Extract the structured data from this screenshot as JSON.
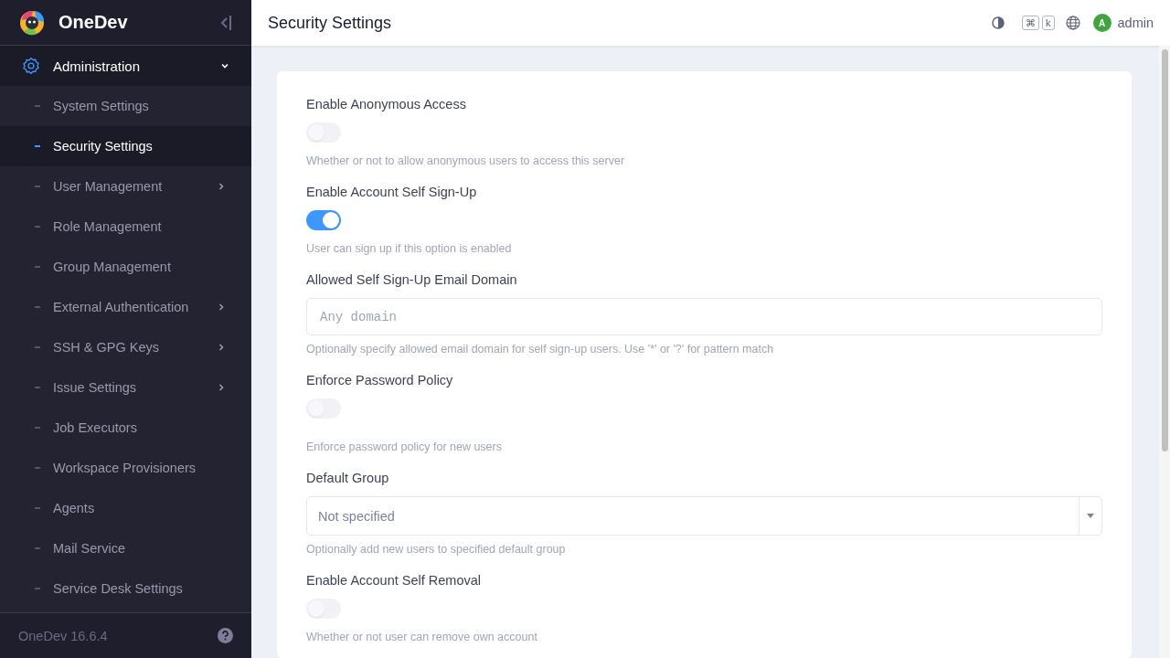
{
  "sidebar": {
    "brand": "OneDev",
    "section": {
      "label": "Administration",
      "expanded": true
    },
    "items": [
      {
        "label": "System Settings",
        "selected": false,
        "expandable": false
      },
      {
        "label": "Security Settings",
        "selected": true,
        "expandable": false
      },
      {
        "label": "User Management",
        "selected": false,
        "expandable": true
      },
      {
        "label": "Role Management",
        "selected": false,
        "expandable": false
      },
      {
        "label": "Group Management",
        "selected": false,
        "expandable": false
      },
      {
        "label": "External Authentication",
        "selected": false,
        "expandable": true
      },
      {
        "label": "SSH & GPG Keys",
        "selected": false,
        "expandable": true
      },
      {
        "label": "Issue Settings",
        "selected": false,
        "expandable": true
      },
      {
        "label": "Job Executors",
        "selected": false,
        "expandable": false
      },
      {
        "label": "Workspace Provisioners",
        "selected": false,
        "expandable": false
      },
      {
        "label": "Agents",
        "selected": false,
        "expandable": false
      },
      {
        "label": "Mail Service",
        "selected": false,
        "expandable": false
      },
      {
        "label": "Service Desk Settings",
        "selected": false,
        "expandable": false
      }
    ],
    "version": "OneDev 16.6.4"
  },
  "header": {
    "title": "Security Settings",
    "shortcut_keys": [
      "⌘",
      "k"
    ],
    "avatar": "A",
    "user": "admin"
  },
  "fields": [
    {
      "kind": "toggle",
      "label": "Enable Anonymous Access",
      "on": false,
      "help": "Whether or not to allow anonymous users to access this server"
    },
    {
      "kind": "toggle",
      "label": "Enable Account Self Sign-Up",
      "on": true,
      "help": "User can sign up if this option is enabled"
    },
    {
      "kind": "text",
      "label": "Allowed Self Sign-Up Email Domain",
      "placeholder": "Any domain",
      "help": "Optionally specify allowed email domain for self sign-up users. Use '*' or '?' for pattern match"
    },
    {
      "kind": "toggle",
      "label": "Enforce Password Policy",
      "on": false,
      "help": "Enforce password policy for new users"
    },
    {
      "kind": "select",
      "label": "Default Group",
      "value": "Not specified",
      "help": "Optionally add new users to specified default group"
    },
    {
      "kind": "toggle",
      "label": "Enable Account Self Removal",
      "on": false,
      "help": "Whether or not user can remove own account"
    }
  ]
}
